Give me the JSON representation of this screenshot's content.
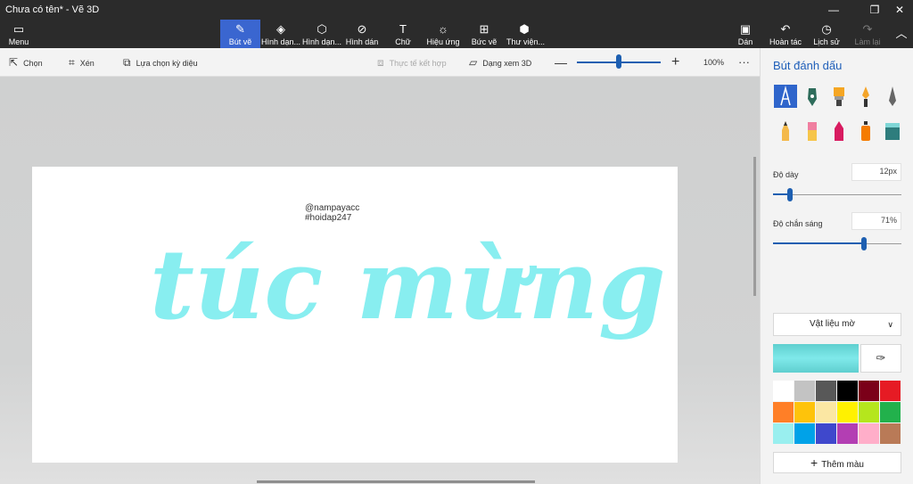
{
  "window": {
    "title": "Chưa có tên* - Vẽ 3D"
  },
  "ribbon": {
    "menu": "Menu",
    "brushes": "Bút vẽ",
    "shapes2d": "Hình dạn...",
    "shapes3d": "Hình dạn...",
    "stickers": "Hình dán",
    "text": "Chữ",
    "effects": "Hiệu ứng",
    "canvas": "Bức vẽ",
    "library": "Thư viện...",
    "paste": "Dán",
    "undo": "Hoàn tác",
    "history": "Lịch sử",
    "redo": "Làm lại"
  },
  "toolbar": {
    "select": "Chọn",
    "crop": "Xén",
    "magic_select": "Lựa chọn kỳ diệu",
    "mixed_reality": "Thực tế kết hợp",
    "view3d": "Dạng xem 3D",
    "zoom": "100%"
  },
  "canvas": {
    "watermark1": "@nampayacc",
    "watermark2": "#hoidap247",
    "handwriting": "túc mừng"
  },
  "panel": {
    "title": "Bút đánh dấu",
    "thickness_label": "Độ dày",
    "thickness_value": "12px",
    "opacity_label": "Độ chắn sáng",
    "opacity_value": "71%",
    "material": "Vật liệu mờ",
    "add_color": "Thêm màu"
  },
  "colors": {
    "accent": "#3a66d0",
    "current": "#7fe9ea",
    "palette": [
      "#ffffff",
      "#c3c3c3",
      "#585858",
      "#000000",
      "#7b0019",
      "#e61b24",
      "#ff7f27",
      "#fec30b",
      "#fbe7a3",
      "#fff100",
      "#b5e61d",
      "#22b14c",
      "#99efef",
      "#00a2e8",
      "#3f48cc",
      "#b33eb3",
      "#ffaec9",
      "#b97a57"
    ]
  },
  "levels": {
    "zoom": 0.5,
    "thickness": 0.13,
    "opacity": 0.71
  }
}
